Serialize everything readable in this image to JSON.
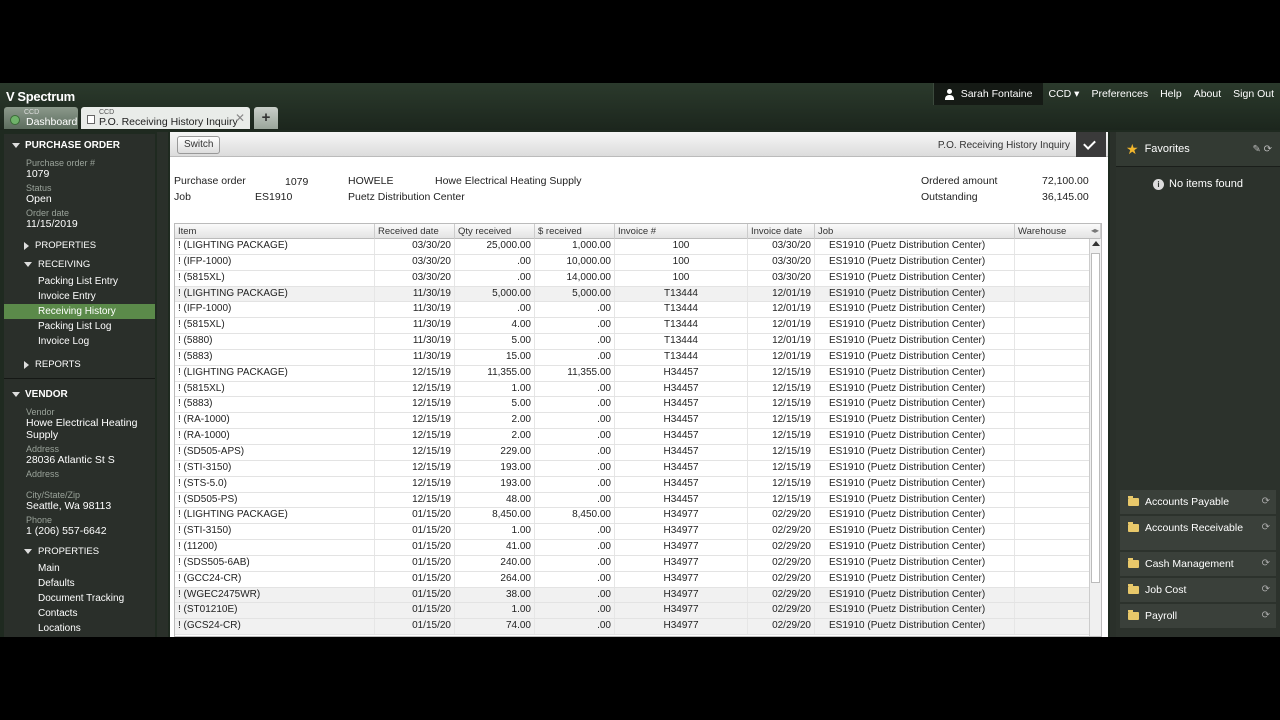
{
  "app": {
    "brand": "Spectrum",
    "user": "Sarah Fontaine",
    "company": "CCD",
    "links": [
      "Preferences",
      "Help",
      "About",
      "Sign Out"
    ]
  },
  "tabs": {
    "dashboard": {
      "small": "CCD",
      "label": "Dashboard"
    },
    "po": {
      "small": "CCD",
      "label": "P.O. Receiving History Inquiry",
      "close": "✕"
    },
    "add": "+"
  },
  "nav": {
    "po_header": "PURCHASE ORDER",
    "po_number_label": "Purchase order #",
    "po_number": "1079",
    "status_label": "Status",
    "status": "Open",
    "order_date_label": "Order date",
    "order_date": "11/15/2019",
    "properties": "PROPERTIES",
    "receiving": "RECEIVING",
    "receiving_items": [
      "Packing List Entry",
      "Invoice Entry",
      "Receiving History",
      "Packing List Log",
      "Invoice Log"
    ],
    "reports": "REPORTS",
    "vendor_header": "VENDOR",
    "vendor_label": "Vendor",
    "vendor": "Howe Electrical Heating Supply",
    "address_label": "Address",
    "address": "28036 Atlantic St S",
    "address2_label": "Address",
    "city_label": "City/State/Zip",
    "city": "Seattle, Wa 98113",
    "phone_label": "Phone",
    "phone": "1 (206) 557-6642",
    "vendor_properties": "PROPERTIES",
    "vendor_items": [
      "Main",
      "Defaults",
      "Document Tracking",
      "Contacts",
      "Locations"
    ]
  },
  "panel": {
    "switch": "Switch",
    "title": "P.O. Receiving History Inquiry",
    "po_label": "Purchase order",
    "po_value": "1079",
    "vendor_code": "HOWELE",
    "vendor_name": "Howe Electrical Heating Supply",
    "job_label": "Job",
    "job_value": "ES1910",
    "job_name": "Puetz Distribution Center",
    "ordered_label": "Ordered amount",
    "ordered_value": "72,100.00",
    "outstanding_label": "Outstanding",
    "outstanding_value": "36,145.00"
  },
  "grid": {
    "columns": [
      "Item",
      "Received date",
      "Qty received",
      "$ received",
      "Invoice #",
      "Invoice date",
      "Job",
      "Warehouse"
    ],
    "rows": [
      [
        "! (LIGHTING PACKAGE)",
        "03/30/20",
        "25,000.00",
        "1,000.00",
        "100",
        "03/30/20",
        "ES1910 (Puetz Distribution Center)",
        ""
      ],
      [
        "! (IFP-1000)",
        "03/30/20",
        ".00",
        "10,000.00",
        "100",
        "03/30/20",
        "ES1910 (Puetz Distribution Center)",
        ""
      ],
      [
        "! (5815XL)",
        "03/30/20",
        ".00",
        "14,000.00",
        "100",
        "03/30/20",
        "ES1910 (Puetz Distribution Center)",
        ""
      ],
      [
        "! (LIGHTING PACKAGE)",
        "11/30/19",
        "5,000.00",
        "5,000.00",
        "T13444",
        "12/01/19",
        "ES1910 (Puetz Distribution Center)",
        ""
      ],
      [
        "! (IFP-1000)",
        "11/30/19",
        ".00",
        ".00",
        "T13444",
        "12/01/19",
        "ES1910 (Puetz Distribution Center)",
        ""
      ],
      [
        "! (5815XL)",
        "11/30/19",
        "4.00",
        ".00",
        "T13444",
        "12/01/19",
        "ES1910 (Puetz Distribution Center)",
        ""
      ],
      [
        "! (5880)",
        "11/30/19",
        "5.00",
        ".00",
        "T13444",
        "12/01/19",
        "ES1910 (Puetz Distribution Center)",
        ""
      ],
      [
        "! (5883)",
        "11/30/19",
        "15.00",
        ".00",
        "T13444",
        "12/01/19",
        "ES1910 (Puetz Distribution Center)",
        ""
      ],
      [
        "! (LIGHTING PACKAGE)",
        "12/15/19",
        "11,355.00",
        "11,355.00",
        "H34457",
        "12/15/19",
        "ES1910 (Puetz Distribution Center)",
        ""
      ],
      [
        "! (5815XL)",
        "12/15/19",
        "1.00",
        ".00",
        "H34457",
        "12/15/19",
        "ES1910 (Puetz Distribution Center)",
        ""
      ],
      [
        "! (5883)",
        "12/15/19",
        "5.00",
        ".00",
        "H34457",
        "12/15/19",
        "ES1910 (Puetz Distribution Center)",
        ""
      ],
      [
        "! (RA-1000)",
        "12/15/19",
        "2.00",
        ".00",
        "H34457",
        "12/15/19",
        "ES1910 (Puetz Distribution Center)",
        ""
      ],
      [
        "! (RA-1000)",
        "12/15/19",
        "2.00",
        ".00",
        "H34457",
        "12/15/19",
        "ES1910 (Puetz Distribution Center)",
        ""
      ],
      [
        "! (SD505-APS)",
        "12/15/19",
        "229.00",
        ".00",
        "H34457",
        "12/15/19",
        "ES1910 (Puetz Distribution Center)",
        ""
      ],
      [
        "! (STI-3150)",
        "12/15/19",
        "193.00",
        ".00",
        "H34457",
        "12/15/19",
        "ES1910 (Puetz Distribution Center)",
        ""
      ],
      [
        "! (STS-5.0)",
        "12/15/19",
        "193.00",
        ".00",
        "H34457",
        "12/15/19",
        "ES1910 (Puetz Distribution Center)",
        ""
      ],
      [
        "! (SD505-PS)",
        "12/15/19",
        "48.00",
        ".00",
        "H34457",
        "12/15/19",
        "ES1910 (Puetz Distribution Center)",
        ""
      ],
      [
        "! (LIGHTING PACKAGE)",
        "01/15/20",
        "8,450.00",
        "8,450.00",
        "H34977",
        "02/29/20",
        "ES1910 (Puetz Distribution Center)",
        ""
      ],
      [
        "! (STI-3150)",
        "01/15/20",
        "1.00",
        ".00",
        "H34977",
        "02/29/20",
        "ES1910 (Puetz Distribution Center)",
        ""
      ],
      [
        "! (11200)",
        "01/15/20",
        "41.00",
        ".00",
        "H34977",
        "02/29/20",
        "ES1910 (Puetz Distribution Center)",
        ""
      ],
      [
        "! (SDS505-6AB)",
        "01/15/20",
        "240.00",
        ".00",
        "H34977",
        "02/29/20",
        "ES1910 (Puetz Distribution Center)",
        ""
      ],
      [
        "! (GCC24-CR)",
        "01/15/20",
        "264.00",
        ".00",
        "H34977",
        "02/29/20",
        "ES1910 (Puetz Distribution Center)",
        ""
      ],
      [
        "! (WGEC2475WR)",
        "01/15/20",
        "38.00",
        ".00",
        "H34977",
        "02/29/20",
        "ES1910 (Puetz Distribution Center)",
        ""
      ],
      [
        "! (ST01210E)",
        "01/15/20",
        "1.00",
        ".00",
        "H34977",
        "02/29/20",
        "ES1910 (Puetz Distribution Center)",
        ""
      ],
      [
        "! (GCS24-CR)",
        "01/15/20",
        "74.00",
        ".00",
        "H34977",
        "02/29/20",
        "ES1910 (Puetz Distribution Center)",
        ""
      ]
    ]
  },
  "right": {
    "favorites": "Favorites",
    "no_items": "No items found",
    "modules": [
      "Accounts Payable",
      "Accounts Receivable",
      "Cash Management",
      "Job Cost",
      "Payroll"
    ]
  }
}
